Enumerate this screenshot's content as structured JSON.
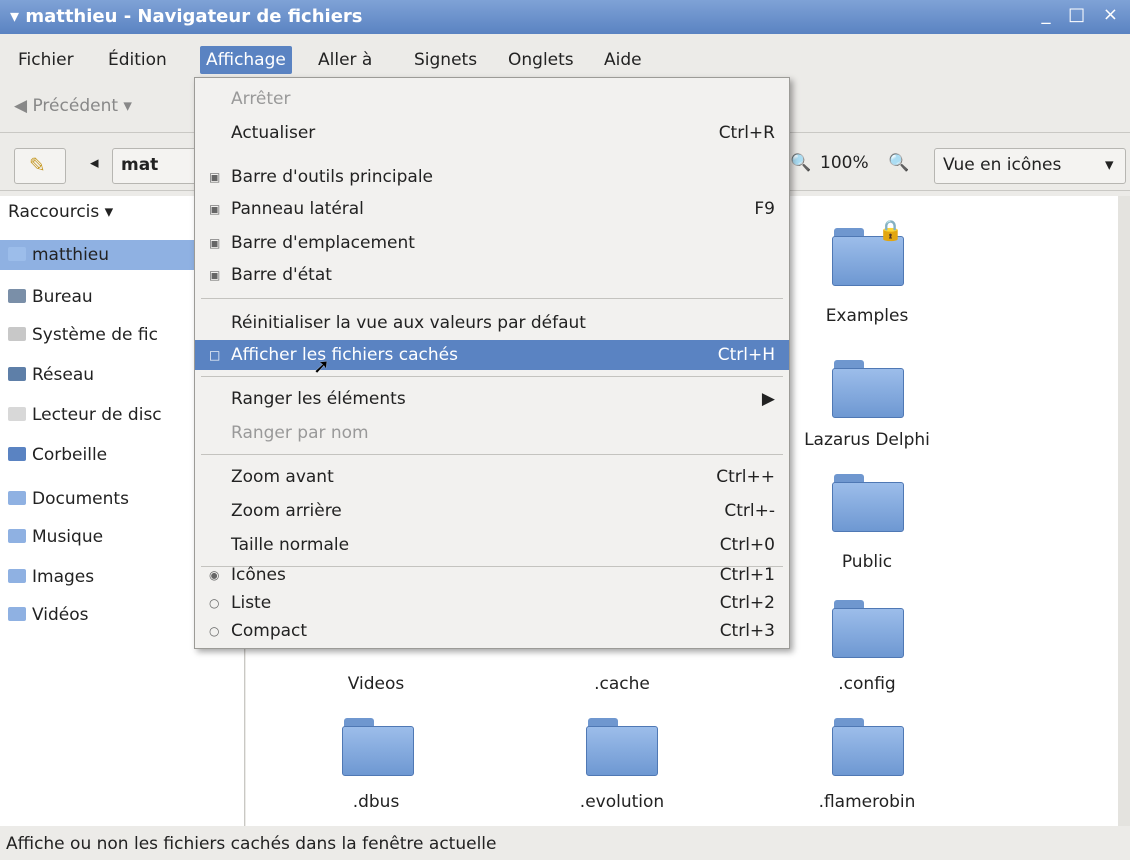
{
  "window": {
    "title": "matthieu - Navigateur de fichiers",
    "controls": "_ □ ×"
  },
  "menubar": {
    "items": [
      "Fichier",
      "Édition",
      "Affichage",
      "Aller à",
      "Signets",
      "Onglets",
      "Aide"
    ]
  },
  "toolbar": {
    "back_label": "Précédent",
    "back_arrow": "▾"
  },
  "location": {
    "path_button": "mat",
    "zoom": "100%",
    "view_mode": "Vue en icônes"
  },
  "sidebar": {
    "header": "Raccourcis ▾",
    "items": [
      {
        "label": "matthieu",
        "icon": "home-icon"
      },
      {
        "label": "Bureau",
        "icon": "desktop-icon"
      },
      {
        "label": "Système de fic",
        "icon": "drive-icon"
      },
      {
        "label": "Réseau",
        "icon": "network-icon"
      },
      {
        "label": "Lecteur de disc",
        "icon": "drive-icon"
      },
      {
        "label": "Corbeille",
        "icon": "trash-icon"
      },
      {
        "label": "Documents",
        "icon": "folder-icon"
      },
      {
        "label": "Musique",
        "icon": "folder-icon"
      },
      {
        "label": "Images",
        "icon": "folder-icon"
      },
      {
        "label": "Vidéos",
        "icon": "folder-icon"
      }
    ]
  },
  "files": [
    {
      "name": "Examples"
    },
    {
      "name": "Lazarus Delphi"
    },
    {
      "name": "Public"
    },
    {
      "name": "Videos"
    },
    {
      "name": ".cache"
    },
    {
      "name": ".config"
    },
    {
      "name": ".dbus"
    },
    {
      "name": ".evolution"
    },
    {
      "name": ".flamerobin"
    }
  ],
  "menu": {
    "items": [
      {
        "label": "Arrêter",
        "shortcut": "",
        "mark": "",
        "disabled": true
      },
      {
        "label": "Actualiser",
        "shortcut": "Ctrl+R",
        "mark": ""
      },
      {
        "label": "Barre d'outils principale",
        "shortcut": "",
        "mark": "▣"
      },
      {
        "label": "Panneau latéral",
        "shortcut": "F9",
        "mark": "▣"
      },
      {
        "label": "Barre d'emplacement",
        "shortcut": "",
        "mark": "▣"
      },
      {
        "label": "Barre d'état",
        "shortcut": "",
        "mark": "▣"
      },
      {
        "label": "Réinitialiser la vue aux valeurs par défaut",
        "shortcut": "",
        "mark": ""
      },
      {
        "label": "Afficher les fichiers cachés",
        "shortcut": "Ctrl+H",
        "mark": "□",
        "highlighted": true
      },
      {
        "label": "Ranger les éléments",
        "shortcut": "▶",
        "mark": ""
      },
      {
        "label": "Ranger par nom",
        "shortcut": "",
        "mark": "",
        "disabled": true
      },
      {
        "label": "Zoom avant",
        "shortcut": "Ctrl++",
        "mark": ""
      },
      {
        "label": "Zoom arrière",
        "shortcut": "Ctrl+-",
        "mark": ""
      },
      {
        "label": "Taille normale",
        "shortcut": "Ctrl+0",
        "mark": ""
      },
      {
        "label": "Icônes",
        "shortcut": "Ctrl+1",
        "mark": "◉"
      },
      {
        "label": "Liste",
        "shortcut": "Ctrl+2",
        "mark": "○"
      },
      {
        "label": "Compact",
        "shortcut": "Ctrl+3",
        "mark": "○"
      }
    ]
  },
  "statusbar": {
    "text": "Affiche ou non les fichiers cachés dans la fenêtre actuelle"
  }
}
